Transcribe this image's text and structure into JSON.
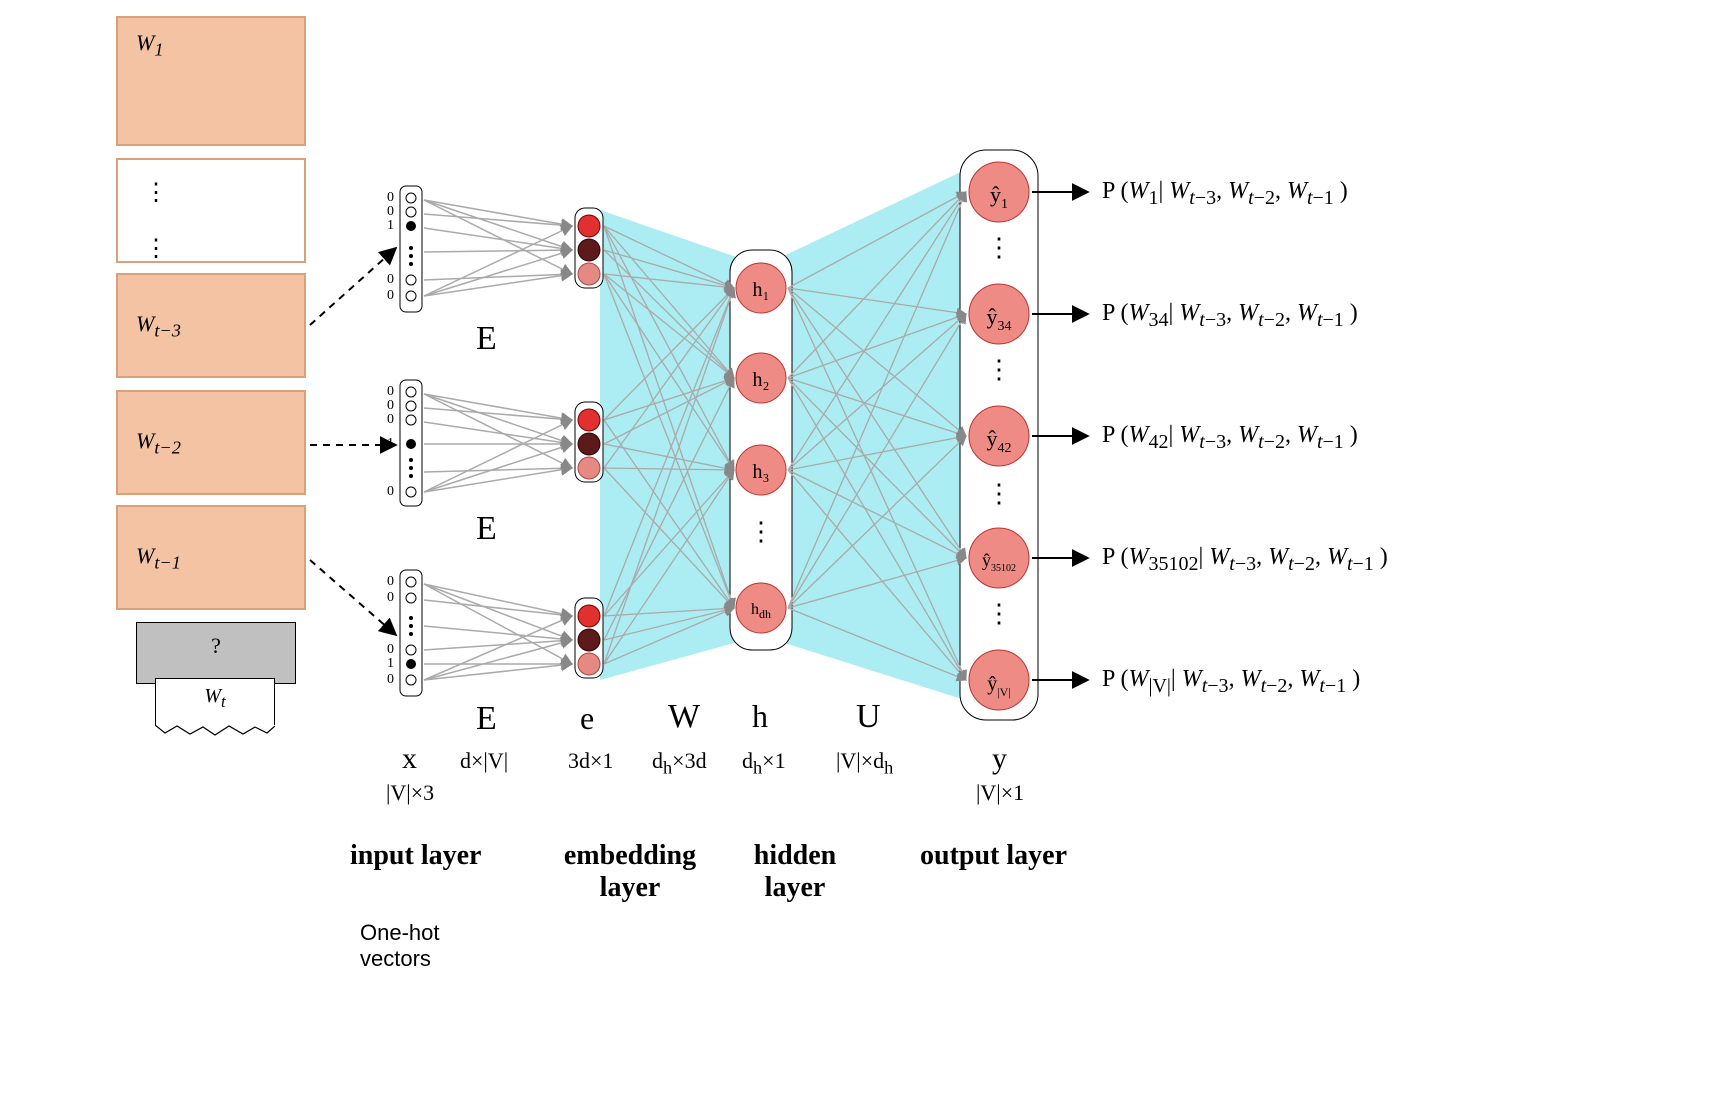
{
  "words": {
    "w1": "W₁",
    "wt3": "W_{t-3}",
    "wt2": "W_{t-2}",
    "wt1": "W_{t-1}",
    "wt": "W_t"
  },
  "question": "?",
  "matrices": {
    "E1": "E",
    "E2": "E",
    "E3": "E",
    "e_vec": "e",
    "W": "W",
    "h_vec": "h",
    "U": "U",
    "x": "x",
    "y": "y"
  },
  "dims": {
    "x": "|V|×3",
    "dV": "d×|V|",
    "e": "3d×1",
    "W": "d_h×3d",
    "h": "d_h×1",
    "U": "|V|×d_h",
    "y": "|V|×1"
  },
  "hidden": [
    "h₁",
    "h₂",
    "h₃",
    "h_{dh}"
  ],
  "output": [
    "ŷ₁",
    "ŷ₃₄",
    "ŷ₄₂",
    "ŷ₃₅₁₀₂",
    "ŷ_{|V|}"
  ],
  "probs": [
    "P (W₁ |  W_{t-3}, W_{t-2}, W_{t-1} )",
    "P (W₃₄ |  W_{t-3}, W_{t-2}, W_{t-1} )",
    "P (W₄₂ |  W_{t-3}, W_{t-2}, W_{t-1} )",
    "P (W₃₅₁₀₂ |  W_{t-3}, W_{t-2}, W_{t-1} )",
    "P (W_{|V|} |  W_{t-3}, W_{t-2}, W_{t-1} )"
  ],
  "layer_labels": {
    "input": "input layer",
    "embedding": "embedding layer",
    "hidden": "hidden layer",
    "output": "output layer"
  },
  "note": "One-hot vectors",
  "vdots": "⋮"
}
